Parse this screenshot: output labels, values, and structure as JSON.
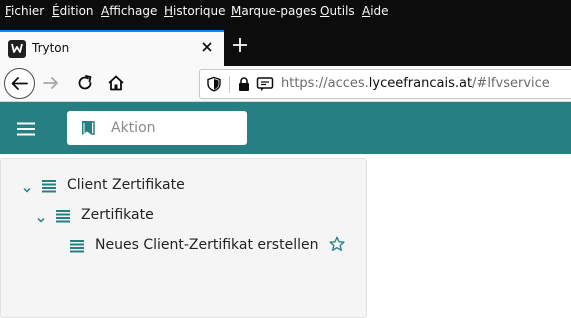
{
  "menubar": {
    "items": [
      {
        "u": "F",
        "rest": "ichier"
      },
      {
        "u": "É",
        "rest": "dition"
      },
      {
        "u": "A",
        "rest": "ffichage"
      },
      {
        "u": "H",
        "rest": "istorique"
      },
      {
        "u": "M",
        "rest": "arque-pages"
      },
      {
        "u": "O",
        "rest": "utils"
      },
      {
        "u": "A",
        "rest": "ide"
      }
    ]
  },
  "tab": {
    "title": "Tryton"
  },
  "urlbar": {
    "prefix": "https://acces.",
    "domain": "lyceefrancais.at",
    "suffix": "/#lfvservice"
  },
  "search": {
    "placeholder": "Aktion"
  },
  "tree": {
    "items": [
      {
        "label": "Client Zertifikate"
      },
      {
        "label": "Zertifikate"
      },
      {
        "label": "Neues Client-Zertifikat erstellen"
      }
    ]
  },
  "colors": {
    "header": "#267f82",
    "accent": "#267f82",
    "browser_dark": "#0c0c0d"
  }
}
